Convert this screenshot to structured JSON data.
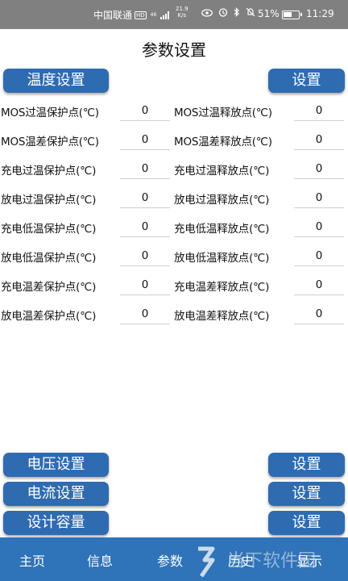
{
  "status_bar": {
    "carrier": "中国联通",
    "hd": "HD",
    "signal_small": [
      "46",
      "ıll"
    ],
    "speed_value": "21.9",
    "speed_unit": "K/s",
    "battery_pct": "51%",
    "time": "11:29"
  },
  "page": {
    "title": "参数设置"
  },
  "temperature": {
    "section_label": "温度设置",
    "set_label": "设置",
    "rows": [
      {
        "left_label": "MOS过温保护点(℃)",
        "left_value": "0",
        "right_label": "MOS过温释放点(℃)",
        "right_value": "0"
      },
      {
        "left_label": "MOS温差保护点(℃)",
        "left_value": "0",
        "right_label": "MOS温差释放点(℃)",
        "right_value": "0"
      },
      {
        "left_label": "充电过温保护点(℃)",
        "left_value": "0",
        "right_label": "充电过温释放点(℃)",
        "right_value": "0"
      },
      {
        "left_label": "放电过温保护点(℃)",
        "left_value": "0",
        "right_label": "放电过温释放点(℃)",
        "right_value": "0"
      },
      {
        "left_label": "充电低温保护点(℃)",
        "left_value": "0",
        "right_label": "充电低温释放点(℃)",
        "right_value": "0"
      },
      {
        "left_label": "放电低温保护点(℃)",
        "left_value": "0",
        "right_label": "放电低温释放点(℃)",
        "right_value": "0"
      },
      {
        "left_label": "充电温差保护点(℃)",
        "left_value": "0",
        "right_label": "充电温差释放点(℃)",
        "right_value": "0"
      },
      {
        "left_label": "放电温差保护点(℃)",
        "left_value": "0",
        "right_label": "放电温差释放点(℃)",
        "right_value": "0"
      }
    ]
  },
  "voltage": {
    "section_label": "电压设置",
    "set_label": "设置"
  },
  "current": {
    "section_label": "电流设置",
    "set_label": "设置"
  },
  "capacity": {
    "section_label": "设计容量",
    "set_label": "设置"
  },
  "tabs": [
    {
      "label": "主页"
    },
    {
      "label": "信息"
    },
    {
      "label": "参数"
    },
    {
      "label": "历史"
    },
    {
      "label": "显示"
    }
  ],
  "colors": {
    "button_blue": "#2f6bb1",
    "tabbar_blue": "#2f73b8",
    "status_bar_gray": "#808080"
  },
  "watermark": {
    "text": "当下软件园"
  }
}
